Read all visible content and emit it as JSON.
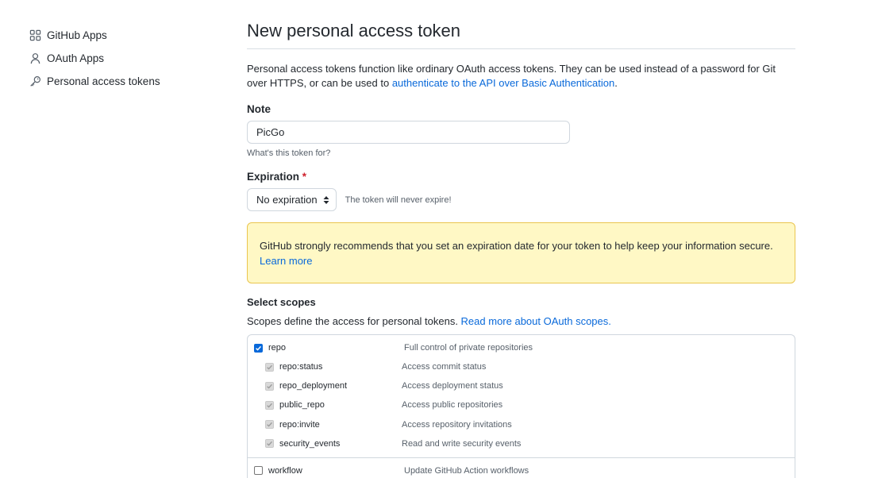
{
  "sidebar": {
    "items": [
      {
        "label": "GitHub Apps",
        "icon": "apps-icon"
      },
      {
        "label": "OAuth Apps",
        "icon": "person-icon"
      },
      {
        "label": "Personal access tokens",
        "icon": "key-icon"
      }
    ]
  },
  "main": {
    "title": "New personal access token",
    "intro_text": "Personal access tokens function like ordinary OAuth access tokens. They can be used instead of a password for Git over HTTPS, or can be used to ",
    "intro_link": "authenticate to the API over Basic Authentication",
    "intro_end": ".",
    "note": {
      "label": "Note",
      "value": "PicGo",
      "hint": "What's this token for?"
    },
    "expiration": {
      "label": "Expiration",
      "required_mark": "*",
      "selected": "No expiration",
      "note": "The token will never expire!"
    },
    "flash": {
      "text": "GitHub strongly recommends that you set an expiration date for your token to help keep your information secure.",
      "link": "Learn more"
    },
    "scopes": {
      "title": "Select scopes",
      "desc": "Scopes define the access for personal tokens. ",
      "desc_link": "Read more about OAuth scopes.",
      "groups": [
        {
          "name": "repo",
          "desc": "Full control of private repositories",
          "checked": true,
          "children": [
            {
              "name": "repo:status",
              "desc": "Access commit status"
            },
            {
              "name": "repo_deployment",
              "desc": "Access deployment status"
            },
            {
              "name": "public_repo",
              "desc": "Access public repositories"
            },
            {
              "name": "repo:invite",
              "desc": "Access repository invitations"
            },
            {
              "name": "security_events",
              "desc": "Read and write security events"
            }
          ]
        },
        {
          "name": "workflow",
          "desc": "Update GitHub Action workflows",
          "checked": false,
          "children": []
        }
      ]
    }
  },
  "colors": {
    "link": "#0969da",
    "flash_bg": "#fff8c5",
    "flash_border": "#eac54f",
    "required": "#cf222e"
  }
}
